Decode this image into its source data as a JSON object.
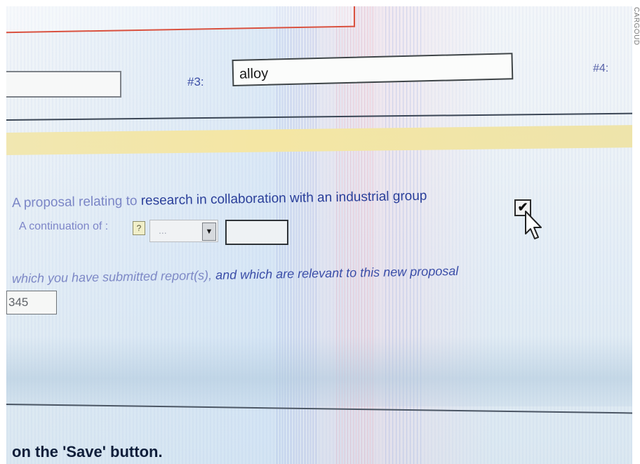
{
  "credit": "CARGOUD",
  "form": {
    "keyword_3_label": "#3:",
    "keyword_3_value": "alloy",
    "keyword_4_label": "#4:",
    "industrial_label_faded": "A proposal relating to ",
    "industrial_label_main": "research in collaboration with an industrial group",
    "industrial_checked_glyph": "✔",
    "continuation_label": "A continuation of :",
    "help_glyph": "?",
    "continuation_select_value": "...",
    "continuation_select_arrow": "▼",
    "reports_text_faded": "which you have submitted report(s), ",
    "reports_text_main": "and which are relevant to this new proposal",
    "reports_number_value": "345",
    "save_instruction": "on the 'Save' button."
  },
  "colors": {
    "label_blue": "#2a3f9a",
    "faded_blue": "#7b86c6",
    "yellow_band": "#f1e7b1",
    "red_border": "#d9513f"
  }
}
